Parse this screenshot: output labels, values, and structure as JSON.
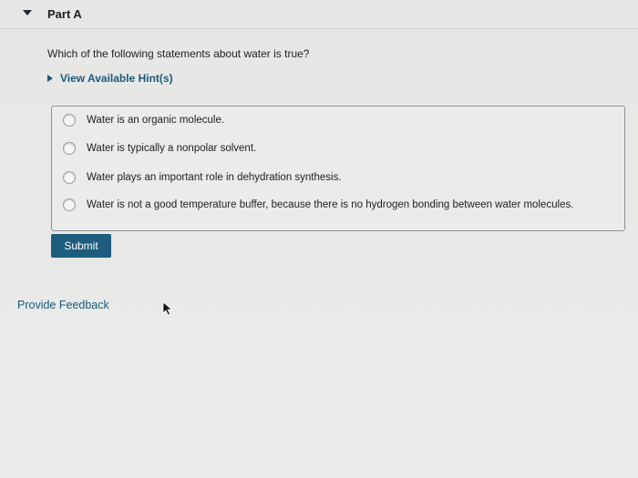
{
  "part": {
    "title": "Part A"
  },
  "question": {
    "text": "Which of the following statements about water is true?"
  },
  "hint": {
    "label": "View Available Hint(s)"
  },
  "options": [
    "Water is an organic molecule.",
    "Water is typically a nonpolar solvent.",
    "Water plays an important role in dehydration synthesis.",
    "Water is not a good temperature buffer, because there is no hydrogen bonding between water molecules."
  ],
  "actions": {
    "submit_label": "Submit",
    "feedback_label": "Provide Feedback"
  },
  "colors": {
    "accent": "#1d5d7d",
    "link": "#1a5a7a"
  }
}
